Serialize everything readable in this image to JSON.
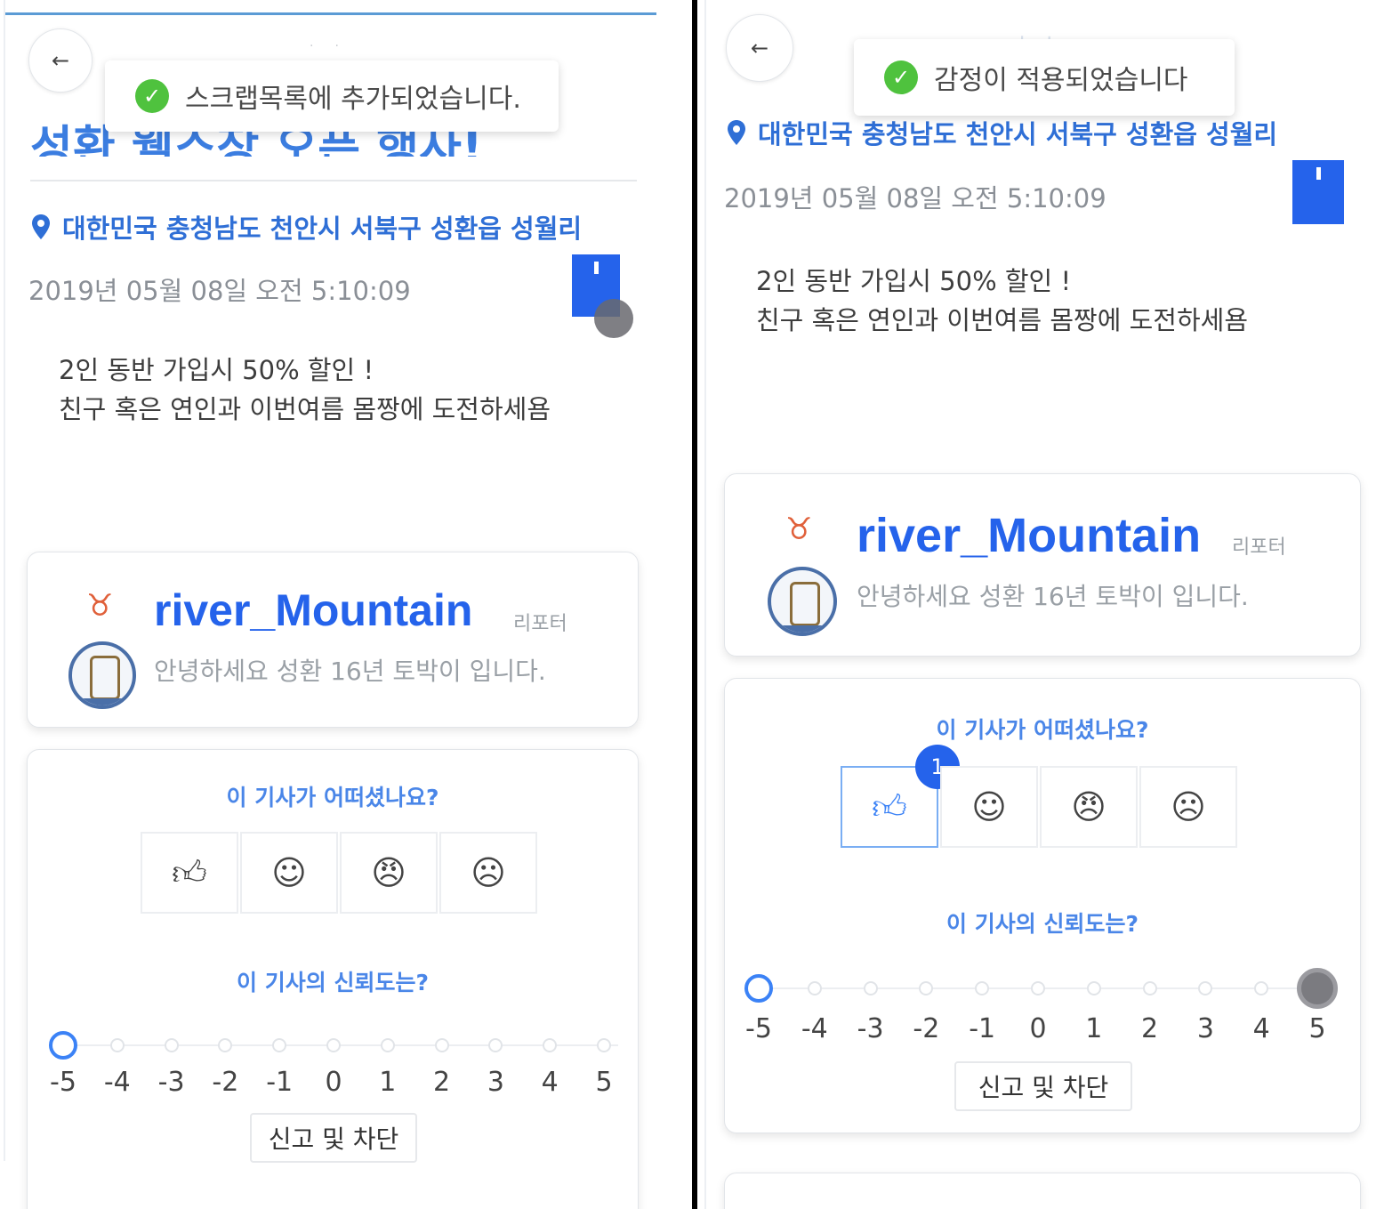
{
  "left": {
    "toast": "스크랩목록에 추가되었습니다.",
    "title": "성환 웰스장 오픈 행사!",
    "location": "대한민국 충청남도 천안시 서북구 성환읍 성월리",
    "date": "2019년 05월 08일 오전 5:10:09",
    "body_lines": [
      "2인 동반 가입시 50% 할인 !",
      "친구 혹은 연인과 이번여름 몸짱에 도전하세욤"
    ],
    "profile": {
      "username": "river_Mountain",
      "role": "리포터",
      "bio": "안녕하세요 성환 16년 토박이 입니다."
    },
    "reaction_question": "이 기사가 어떠셨나요?",
    "trust_question": "이 기사의 신뢰도는?",
    "report_label": "신고 및 차단"
  },
  "right": {
    "toast": "감정이 적용되었습니다",
    "faint_header": "뉴스",
    "location": "대한민국 충청남도 천안시 서북구 성환읍 성월리",
    "date": "2019년 05월 08일 오전 5:10:09",
    "body_lines": [
      "2인 동반 가입시 50% 할인 !",
      "친구 혹은 연인과 이번여름 몸짱에 도전하세욤"
    ],
    "profile": {
      "username": "river_Mountain",
      "role": "리포터",
      "bio": "안녕하세요 성환 16년 토박이 입니다."
    },
    "reaction_question": "이 기사가 어떠셨나요?",
    "like_count": "1",
    "trust_question": "이 기사의 신뢰도는?",
    "report_label": "신고 및 차단"
  },
  "slider_labels": [
    "-5",
    "-4",
    "-3",
    "-2",
    "-1",
    "0",
    "1",
    "2",
    "3",
    "4",
    "5"
  ],
  "icons": {
    "back": "arrow-left-icon",
    "check": "check-circle-icon",
    "pin": "location-pin-icon",
    "bookmark": "bookmark-icon",
    "badge": "taurus-badge-icon",
    "reactions": [
      "thumbs-up-icon",
      "smile-icon",
      "angry-icon",
      "sad-icon"
    ]
  },
  "colors": {
    "accent": "#2563eb",
    "title": "#3b7de0",
    "toast_check": "#4fc23e"
  }
}
